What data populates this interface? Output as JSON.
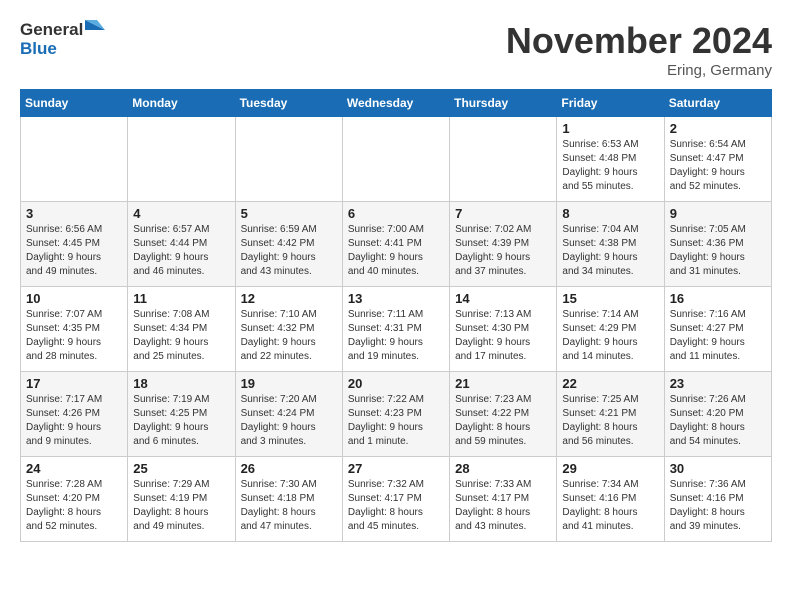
{
  "logo": {
    "text_general": "General",
    "text_blue": "Blue"
  },
  "header": {
    "month": "November 2024",
    "location": "Ering, Germany"
  },
  "weekdays": [
    "Sunday",
    "Monday",
    "Tuesday",
    "Wednesday",
    "Thursday",
    "Friday",
    "Saturday"
  ],
  "weeks": [
    [
      {
        "day": "",
        "info": ""
      },
      {
        "day": "",
        "info": ""
      },
      {
        "day": "",
        "info": ""
      },
      {
        "day": "",
        "info": ""
      },
      {
        "day": "",
        "info": ""
      },
      {
        "day": "1",
        "info": "Sunrise: 6:53 AM\nSunset: 4:48 PM\nDaylight: 9 hours\nand 55 minutes."
      },
      {
        "day": "2",
        "info": "Sunrise: 6:54 AM\nSunset: 4:47 PM\nDaylight: 9 hours\nand 52 minutes."
      }
    ],
    [
      {
        "day": "3",
        "info": "Sunrise: 6:56 AM\nSunset: 4:45 PM\nDaylight: 9 hours\nand 49 minutes."
      },
      {
        "day": "4",
        "info": "Sunrise: 6:57 AM\nSunset: 4:44 PM\nDaylight: 9 hours\nand 46 minutes."
      },
      {
        "day": "5",
        "info": "Sunrise: 6:59 AM\nSunset: 4:42 PM\nDaylight: 9 hours\nand 43 minutes."
      },
      {
        "day": "6",
        "info": "Sunrise: 7:00 AM\nSunset: 4:41 PM\nDaylight: 9 hours\nand 40 minutes."
      },
      {
        "day": "7",
        "info": "Sunrise: 7:02 AM\nSunset: 4:39 PM\nDaylight: 9 hours\nand 37 minutes."
      },
      {
        "day": "8",
        "info": "Sunrise: 7:04 AM\nSunset: 4:38 PM\nDaylight: 9 hours\nand 34 minutes."
      },
      {
        "day": "9",
        "info": "Sunrise: 7:05 AM\nSunset: 4:36 PM\nDaylight: 9 hours\nand 31 minutes."
      }
    ],
    [
      {
        "day": "10",
        "info": "Sunrise: 7:07 AM\nSunset: 4:35 PM\nDaylight: 9 hours\nand 28 minutes."
      },
      {
        "day": "11",
        "info": "Sunrise: 7:08 AM\nSunset: 4:34 PM\nDaylight: 9 hours\nand 25 minutes."
      },
      {
        "day": "12",
        "info": "Sunrise: 7:10 AM\nSunset: 4:32 PM\nDaylight: 9 hours\nand 22 minutes."
      },
      {
        "day": "13",
        "info": "Sunrise: 7:11 AM\nSunset: 4:31 PM\nDaylight: 9 hours\nand 19 minutes."
      },
      {
        "day": "14",
        "info": "Sunrise: 7:13 AM\nSunset: 4:30 PM\nDaylight: 9 hours\nand 17 minutes."
      },
      {
        "day": "15",
        "info": "Sunrise: 7:14 AM\nSunset: 4:29 PM\nDaylight: 9 hours\nand 14 minutes."
      },
      {
        "day": "16",
        "info": "Sunrise: 7:16 AM\nSunset: 4:27 PM\nDaylight: 9 hours\nand 11 minutes."
      }
    ],
    [
      {
        "day": "17",
        "info": "Sunrise: 7:17 AM\nSunset: 4:26 PM\nDaylight: 9 hours\nand 9 minutes."
      },
      {
        "day": "18",
        "info": "Sunrise: 7:19 AM\nSunset: 4:25 PM\nDaylight: 9 hours\nand 6 minutes."
      },
      {
        "day": "19",
        "info": "Sunrise: 7:20 AM\nSunset: 4:24 PM\nDaylight: 9 hours\nand 3 minutes."
      },
      {
        "day": "20",
        "info": "Sunrise: 7:22 AM\nSunset: 4:23 PM\nDaylight: 9 hours\nand 1 minute."
      },
      {
        "day": "21",
        "info": "Sunrise: 7:23 AM\nSunset: 4:22 PM\nDaylight: 8 hours\nand 59 minutes."
      },
      {
        "day": "22",
        "info": "Sunrise: 7:25 AM\nSunset: 4:21 PM\nDaylight: 8 hours\nand 56 minutes."
      },
      {
        "day": "23",
        "info": "Sunrise: 7:26 AM\nSunset: 4:20 PM\nDaylight: 8 hours\nand 54 minutes."
      }
    ],
    [
      {
        "day": "24",
        "info": "Sunrise: 7:28 AM\nSunset: 4:20 PM\nDaylight: 8 hours\nand 52 minutes."
      },
      {
        "day": "25",
        "info": "Sunrise: 7:29 AM\nSunset: 4:19 PM\nDaylight: 8 hours\nand 49 minutes."
      },
      {
        "day": "26",
        "info": "Sunrise: 7:30 AM\nSunset: 4:18 PM\nDaylight: 8 hours\nand 47 minutes."
      },
      {
        "day": "27",
        "info": "Sunrise: 7:32 AM\nSunset: 4:17 PM\nDaylight: 8 hours\nand 45 minutes."
      },
      {
        "day": "28",
        "info": "Sunrise: 7:33 AM\nSunset: 4:17 PM\nDaylight: 8 hours\nand 43 minutes."
      },
      {
        "day": "29",
        "info": "Sunrise: 7:34 AM\nSunset: 4:16 PM\nDaylight: 8 hours\nand 41 minutes."
      },
      {
        "day": "30",
        "info": "Sunrise: 7:36 AM\nSunset: 4:16 PM\nDaylight: 8 hours\nand 39 minutes."
      }
    ]
  ]
}
